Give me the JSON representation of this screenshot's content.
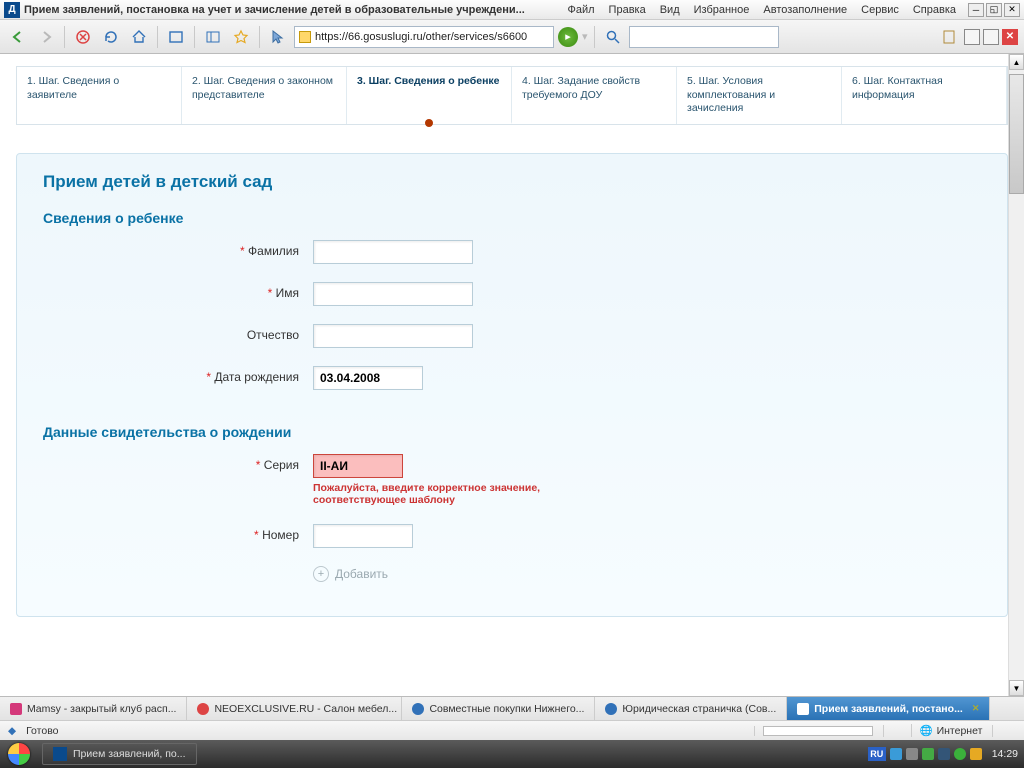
{
  "window": {
    "title": "Прием заявлений, постановка на учет и зачисление детей в образовательные учреждени...",
    "menu": [
      "Файл",
      "Правка",
      "Вид",
      "Избранное",
      "Автозаполнение",
      "Сервис",
      "Справка"
    ]
  },
  "url": "https://66.gosuslugi.ru/other/services/s6600",
  "steps": [
    "1. Шаг. Сведения о заявителе",
    "2. Шаг. Сведения о законном представителе",
    "3. Шаг. Сведения о ребенке",
    "4. Шаг. Задание свойств требуемого ДОУ",
    "5. Шаг. Условия комплектования и зачисления",
    "6. Шаг. Контактная информация"
  ],
  "form": {
    "title": "Прием детей в детский сад",
    "section1": "Сведения о ребенке",
    "lastname_label": "Фамилия",
    "firstname_label": "Имя",
    "middlename_label": "Отчество",
    "dob_label": "Дата рождения",
    "dob_value": "03.04.2008",
    "section2": "Данные свидетельства о рождении",
    "series_label": "Серия",
    "series_value": "II-АИ",
    "series_error": "Пожалуйста, введите корректное значение, соответствующее шаблону",
    "number_label": "Номер",
    "add_label": "Добавить"
  },
  "tabs": [
    "Mamsy - закрытый клуб расп...",
    "NEOEXCLUSIVE.RU - Салон мебел...",
    "Совместные покупки Нижнего...",
    "Юридическая страничка (Сов...",
    "Прием заявлений, постано..."
  ],
  "status": {
    "ready": "Готово",
    "zone": "Интернет"
  },
  "taskbar": {
    "app": "Прием заявлений, по...",
    "lang": "RU",
    "time": "14:29"
  }
}
